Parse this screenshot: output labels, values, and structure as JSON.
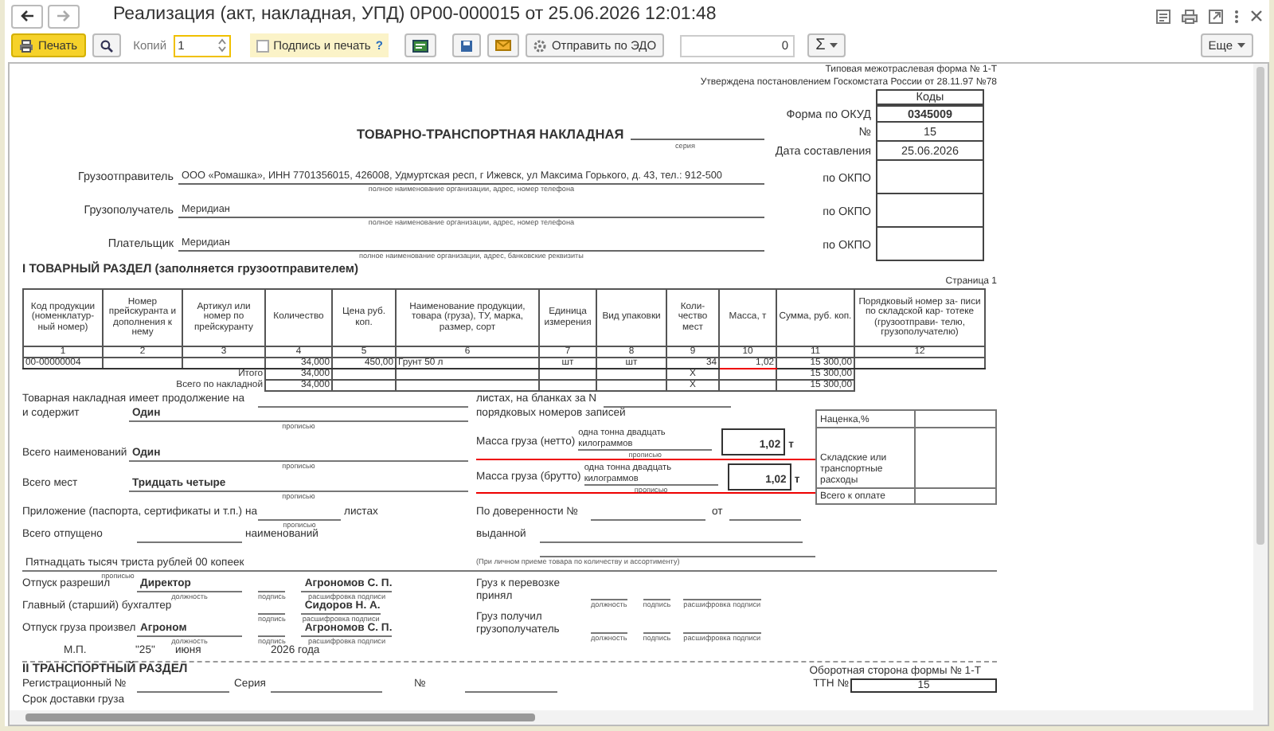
{
  "window": {
    "title": "Реализация (акт, накладная, УПД) 0Р00-000015 от 25.06.2026 12:01:48"
  },
  "toolbar": {
    "print": "Печать",
    "copies_label": "Копий",
    "copies": "1",
    "sign_print": {
      "label": "Подпись и печать",
      "checked": false
    },
    "help": "?",
    "send_edo": "Отправить по ЭДО",
    "counter": "0",
    "sum": "Σ",
    "more": "Еще"
  },
  "header": {
    "form_type": "Типовая межотраслевая форма № 1-Т",
    "approved": "Утверждена постановлением Госкомстата России от 28.11.97 №78",
    "title": "ТОВАРНО-ТРАНСПОРТНАЯ НАКЛАДНАЯ",
    "series_caption": "серия",
    "codes": "Коды",
    "okud_label": "Форма по ОКУД",
    "okud": "0345009",
    "number_label": "№",
    "number": "15",
    "date_label": "Дата составления",
    "date": "25.06.2026"
  },
  "parties": [
    {
      "label": "Грузоотправитель",
      "value": "ООО «Ромашка», ИНН 7701356015, 426008, Удмуртская респ, г Ижевск, ул Максима Горького, д. 43, тел.: 912-500",
      "caption": "полное наименование организации, адрес, номер телефона",
      "okpo_label": "по ОКПО"
    },
    {
      "label": "Грузополучатель",
      "value": "Меридиан",
      "caption": "полное наименование организации, адрес, номер телефона",
      "okpo_label": "по ОКПО"
    },
    {
      "label": "Плательщик",
      "value": "Меридиан",
      "caption": "полное наименование организации, адрес, банковские реквизиты",
      "okpo_label": "по ОКПО"
    }
  ],
  "goods": {
    "title": "I ТОВАРНЫЙ РАЗДЕЛ (заполняется грузоотправителем)",
    "page": "Страница 1",
    "columns": [
      "Код продукции (номенклатур- ный номер)",
      "Номер прейскуранта и дополнения к нему",
      "Артикул или номер по прейскуранту",
      "Количество",
      "Цена руб. коп.",
      "Наименование продукции, товара (груза), ТУ, марка, размер, сорт",
      "Единица измерения",
      "Вид упаковки",
      "Коли- чество мест",
      "Масса, т",
      "Сумма, руб. коп.",
      "Порядковый номер за- писи по складской кар- тотеке (грузоотправи- телю, грузополучателю)"
    ],
    "numbers": [
      "1",
      "2",
      "3",
      "4",
      "5",
      "6",
      "7",
      "8",
      "9",
      "10",
      "11",
      "12"
    ],
    "rows": [
      {
        "cells": [
          "00-00000004",
          "",
          "",
          "34,000",
          "450,00",
          "Грунт 50 л",
          "шт",
          "шт",
          "34",
          "1,02",
          "15 300,00",
          ""
        ],
        "mass_flagged": true
      }
    ],
    "totals": [
      {
        "label": "Итого",
        "quantity": "34,000",
        "places": "X",
        "sum": "15 300,00"
      },
      {
        "label": "Всего по накладной",
        "quantity": "34,000",
        "places": "X",
        "sum": "15 300,00"
      }
    ]
  },
  "summary": {
    "continuation_label": "Товарная накладная имеет продолжение на",
    "sheets_label": "листах, на бланках за N",
    "contains_label": "и содержит",
    "records": {
      "value": "Один",
      "caption": "прописью"
    },
    "records_label": "порядковых номеров записей",
    "items_label": "Всего наименований",
    "items": {
      "value": "Один",
      "caption": "прописью"
    },
    "places_label": "Всего мест",
    "places": {
      "value": "Тридцать четыре",
      "caption": "прописью"
    },
    "attachment_label": "Приложение (паспорта, сертификаты и т.п.) на",
    "attachment": {
      "caption": "прописью"
    },
    "attachment_sheets_label": "листах",
    "released_label": "Всего отпущено",
    "released_items_label": "наименований",
    "amount": {
      "value": "Пятнадцать тысяч триста рублей 00 копеек",
      "caption": "прописью"
    }
  },
  "masses": [
    {
      "label": "Масса груза (нетто)",
      "words": "одна тонна двадцать килограммов",
      "caption": "прописью",
      "value": "1,02",
      "unit": "т",
      "flagged": true
    },
    {
      "label": "Масса груза (брутто)",
      "words": "одна тонна двадцать килограммов",
      "caption": "прописью",
      "value": "1,02",
      "unit": "т",
      "flagged": true
    }
  ],
  "charges": [
    {
      "label": "Наценка,%"
    },
    {
      "label": "Складские или транспортные расходы"
    },
    {
      "label": "Всего к  оплате"
    }
  ],
  "proxy": {
    "label": "По доверенности №",
    "from_label": "от",
    "issued_label": "выданной",
    "note": "(При личном приеме товара по количеству и ассортименту)"
  },
  "signatures": [
    {
      "label": "Отпуск разрешил",
      "position": {
        "value": "Директор",
        "caption": "должность"
      },
      "signature": {
        "caption": "подпись"
      },
      "name": {
        "value": "Агрономов С. П.",
        "caption": "расшифровка подписи"
      }
    },
    {
      "label": "Главный (старший) бухгалтер",
      "signature": {
        "caption": "подпись"
      },
      "name": {
        "value": "Сидоров Н. А.",
        "caption": "расшифровка подписи"
      }
    },
    {
      "label": "Отпуск груза произвел",
      "position": {
        "value": "Агроном",
        "caption": "должность"
      },
      "signature": {
        "caption": "подпись"
      },
      "name": {
        "value": "Агрономов С. П.",
        "caption": "расшифровка подписи"
      }
    }
  ],
  "receipts": [
    {
      "label": "Груз к перевозке принял",
      "position": {
        "caption": "должность"
      },
      "signature": {
        "caption": "подпись"
      },
      "name": {
        "caption": "расшифровка подписи"
      }
    },
    {
      "label": "Груз получил грузополучатель",
      "position": {
        "caption": "должность"
      },
      "signature": {
        "caption": "подпись"
      },
      "name": {
        "caption": "расшифровка подписи"
      }
    }
  ],
  "stamp": {
    "label": "М.П.",
    "day": "\"25\"",
    "month": "июня",
    "year": "2026 года"
  },
  "transport": {
    "title": "II ТРАНСПОРТНЫЙ РАЗДЕЛ",
    "reverse_note": "Оборотная сторона формы № 1-Т",
    "reg_label": "Регистрационный №",
    "series_label": "Серия",
    "number_label": "№",
    "ttn_label": "ТТН №",
    "ttn": "15",
    "delivery_label": "Срок доставки груза"
  }
}
